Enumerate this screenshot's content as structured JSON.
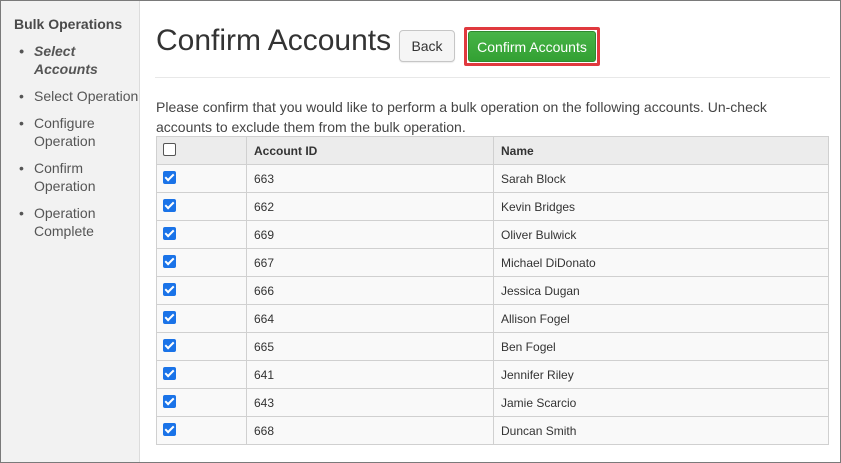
{
  "sidebar": {
    "title": "Bulk Operations",
    "steps": [
      {
        "label": "Select Accounts",
        "active": true
      },
      {
        "label": "Select Operation",
        "active": false
      },
      {
        "label": "Configure Operation",
        "active": false
      },
      {
        "label": "Confirm Operation",
        "active": false
      },
      {
        "label": "Operation Complete",
        "active": false
      }
    ]
  },
  "header": {
    "title": "Confirm Accounts",
    "back_label": "Back",
    "confirm_label": "Confirm Accounts"
  },
  "instructions": "Please confirm that you would like to perform a bulk operation on the following accounts. Un-check accounts to exclude them from the bulk operation.",
  "table": {
    "columns": [
      "",
      "Account ID",
      "Name"
    ],
    "select_all_checked": false,
    "rows": [
      {
        "checked": true,
        "id": "663",
        "name": "Sarah Block"
      },
      {
        "checked": true,
        "id": "662",
        "name": "Kevin Bridges"
      },
      {
        "checked": true,
        "id": "669",
        "name": "Oliver Bulwick"
      },
      {
        "checked": true,
        "id": "667",
        "name": "Michael DiDonato"
      },
      {
        "checked": true,
        "id": "666",
        "name": "Jessica Dugan"
      },
      {
        "checked": true,
        "id": "664",
        "name": "Allison Fogel"
      },
      {
        "checked": true,
        "id": "665",
        "name": "Ben Fogel"
      },
      {
        "checked": true,
        "id": "641",
        "name": "Jennifer Riley"
      },
      {
        "checked": true,
        "id": "643",
        "name": "Jamie Scarcio"
      },
      {
        "checked": true,
        "id": "668",
        "name": "Duncan Smith"
      }
    ]
  },
  "colors": {
    "confirm_button": "#3aa83a",
    "highlight": "#e0393e",
    "checkbox": "#1a73e8",
    "sidebar_bg": "#f2f2f2"
  }
}
